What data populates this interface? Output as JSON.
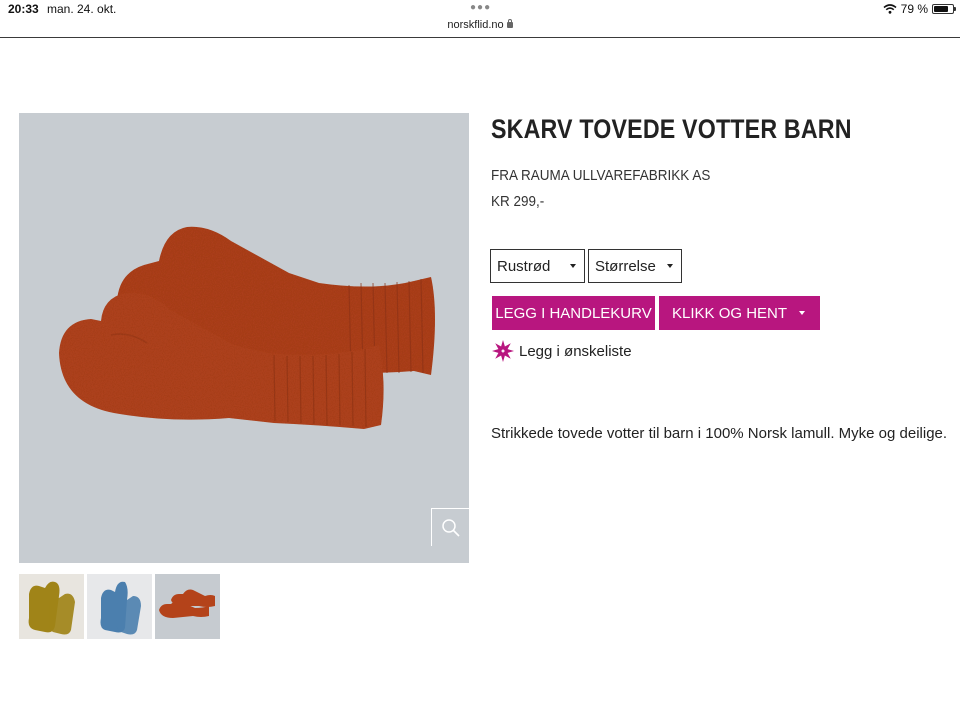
{
  "status_bar": {
    "time": "20:33",
    "date": "man. 24. okt.",
    "url": "norskflid.no",
    "battery": "79 %",
    "battery_level": 0.79
  },
  "product": {
    "title": "SKARV TOVEDE VOTTER BARN",
    "maker": "FRA RAUMA ULLVAREFABRIKK AS",
    "price": "KR 299,-",
    "color_select": {
      "selected": "Rustrød"
    },
    "size_select": {
      "selected": "Størrelse"
    },
    "add_to_cart_label": "LEGG I HANDLEKURV",
    "click_collect_label": "KLIKK OG HENT",
    "wishlist_label": "Legg i ønskeliste",
    "description": "Strikkede tovede votter til barn i 100% Norsk lamull. Myke og deilige.",
    "thumbnails": [
      {
        "name": "mustard",
        "color": "#a08418"
      },
      {
        "name": "blue",
        "color": "#4b7fae"
      },
      {
        "name": "rust",
        "color": "#b4431a"
      }
    ]
  },
  "colors": {
    "accent": "#b8167f",
    "mitten_rust": "#b4431a",
    "image_background": "#c7ccd1"
  }
}
